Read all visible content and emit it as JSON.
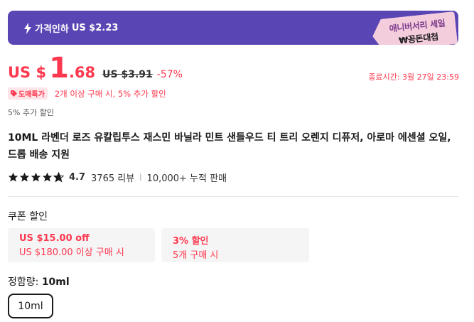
{
  "banner": {
    "label": "가격인하",
    "price": "US $2.23",
    "tag_line1": "애니버서리 세일",
    "tag_line2": "₩꽁돈대첩"
  },
  "price": {
    "currency": "US $",
    "integer": "1",
    "decimal": ".68",
    "original": "US $3.91",
    "discount": "-57%",
    "end_time": "종료시간: 3월 27일 23:59"
  },
  "bulk": {
    "badge": "도매특가",
    "text": "2개 이상 구매 시, 5% 추가 할인"
  },
  "extra_discount": "5% 추가 할인",
  "product_title": "10ML 라벤더 로즈 유칼립투스 재스민 바닐라 민트 샌들우드 티 트리 오렌지 디퓨저, 아로마 에센셜 오일, 드롭 배송 지원",
  "rating": {
    "value": "4.7",
    "stars": 4.7,
    "reviews": "3765 리뷰",
    "sold": "10,000+ 누적 판매"
  },
  "coupons": {
    "title": "쿠폰 할인",
    "items": [
      {
        "main": "US $15.00 off",
        "sub": "US $180.00 이상 구매 시"
      },
      {
        "main": "3% 할인",
        "sub": "5개 구매 시"
      }
    ]
  },
  "volume": {
    "label": "정함량: ",
    "selected": "10ml",
    "options": [
      "10ml"
    ]
  },
  "colors": {
    "accent": "#fd384f",
    "banner": "#5a45b4"
  }
}
